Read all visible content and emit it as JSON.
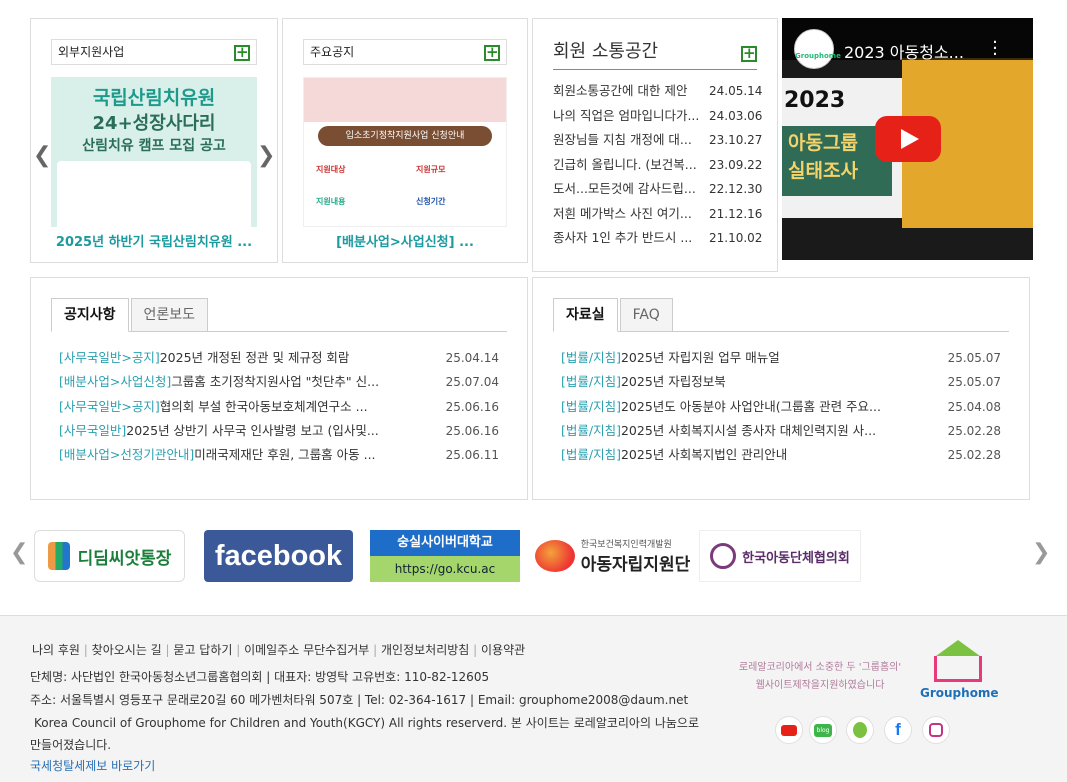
{
  "external": {
    "title": "외부지원사업",
    "img_lines": [
      "국립산림치유원",
      "24+성장사다리",
      "산림치유 캠프 모집 공고"
    ],
    "caption": "2025년 하반기 국립산림치유원 ..."
  },
  "notice_card": {
    "title": "주요공지",
    "img_heading": "입소초기정착지원사업 신청안내",
    "img_items": [
      "지원대상",
      "지원규모",
      "지원내용",
      "신청기간"
    ],
    "caption": "[배분사업>사업신청] ..."
  },
  "community": {
    "title": "회원 소통공간",
    "items": [
      {
        "title": "회원소통공간에 대한 제안",
        "date": "24.05.14"
      },
      {
        "title": "나의 직업은 엄마입니다가...",
        "date": "24.03.06"
      },
      {
        "title": "원장님들 지침 개정에 대...",
        "date": "23.10.27"
      },
      {
        "title": "긴급히 올립니다. (보건복...",
        "date": "23.09.22"
      },
      {
        "title": "도서...모든것에 감사드립...",
        "date": "22.12.30"
      },
      {
        "title": "저흰 메가박스 사진 여기...",
        "date": "21.12.16"
      },
      {
        "title": "종사자 1인 추가 반드시 ...",
        "date": "21.10.02"
      }
    ]
  },
  "video": {
    "title": "2023 아동청소...",
    "logo_text": "Grouphome",
    "big_year": "2023",
    "big_lines": [
      "아동그룹",
      "실태조사"
    ]
  },
  "notices": {
    "tabs": [
      "공지사항",
      "언론보도"
    ],
    "items": [
      {
        "cat": "[사무국일반>공지]",
        "title": "2025년 개정된 정관 및 제규정 회람",
        "date": "25.04.14"
      },
      {
        "cat": "[배분사업>사업신청]",
        "title": "그룹홈 초기정착지원사업 \"첫단추\" 신...",
        "date": "25.07.04"
      },
      {
        "cat": "[사무국일반>공지]",
        "title": "협의회 부설 한국아동보호체계연구소 ...",
        "date": "25.06.16"
      },
      {
        "cat": "[사무국일반]",
        "title": "2025년 상반기 사무국 인사발령 보고 (입사및...",
        "date": "25.06.16"
      },
      {
        "cat": "[배분사업>선정기관안내]",
        "title": "미래국제재단 후원, 그룹홈 아동 ...",
        "date": "25.06.11"
      }
    ]
  },
  "resources": {
    "tabs": [
      "자료실",
      "FAQ"
    ],
    "items": [
      {
        "cat": "[법률/지침]",
        "title": "2025년 자립지원 업무 매뉴얼",
        "date": "25.05.07"
      },
      {
        "cat": "[법률/지침]",
        "title": "2025년 자립정보북",
        "date": "25.05.07"
      },
      {
        "cat": "[법률/지침]",
        "title": "2025년도 아동분야 사업안내(그룹홈 관련 주요...",
        "date": "25.04.08"
      },
      {
        "cat": "[법률/지침]",
        "title": "2025년 사회복지시설 종사자 대체인력지원 사...",
        "date": "25.02.28"
      },
      {
        "cat": "[법률/지침]",
        "title": "2025년 사회복지법인 관리안내",
        "date": "25.02.28"
      }
    ]
  },
  "banners": {
    "didim": "디딤씨앗통장",
    "facebook": "facebook",
    "kcu_name": "숭실사이버대학교",
    "kcu_url": "https://go.kcu.ac",
    "kohi_top": "한국보건복지인력개발원",
    "kohi_main": "아동자립지원단",
    "kcwa": "한국아동단체협의회"
  },
  "footer": {
    "links": [
      "나의 후원",
      "찾아오시는 길",
      "묻고 답하기",
      "이메일주소 무단수집거부",
      "개인정보처리방침",
      "이용약관"
    ],
    "line1": "단체명: 사단법인 한국아동청소년그룹홈협의회 | 대표자: 방영탁 고유번호: 110-82-12605",
    "line2": "주소: 서울특별시 영등포구 문래로20길 60 메가벤처타워 507호 | Tel: 02-364-1617 | Email: grouphome2008@daum.net",
    "line3": "Korea Council of Grouphome for Children and Youth(KGCY) All rights reserverd. 본 사이트는 로레알코리아의 나눔으로",
    "line4": "만들어졌습니다.",
    "line5": "국세청탈세제보 바로가기",
    "loreal1": "로레알코리아에서 소중한 두 '그룹홈의'",
    "loreal2": "웹사이트제작을지원하였습니다",
    "logo": "Grouphome",
    "sns": [
      "youtube-icon",
      "blog-icon",
      "band-icon",
      "facebook-icon",
      "instagram-icon"
    ]
  },
  "colors": {
    "accent": "#1b9a9f",
    "plus": "#2b8a2b",
    "category": "#2aa0b0"
  }
}
